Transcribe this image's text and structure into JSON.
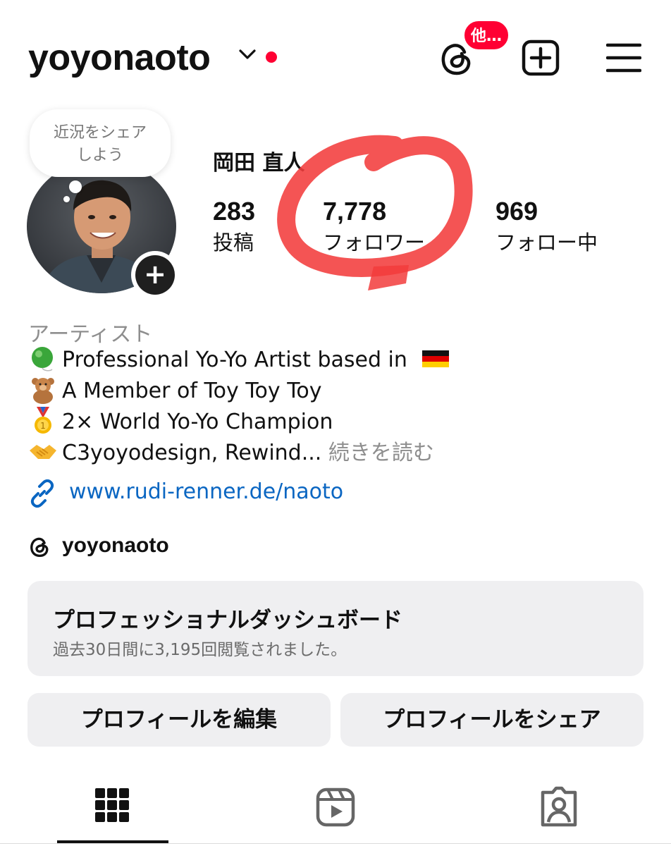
{
  "header": {
    "username": "yoyonaoto",
    "threads_badge": "他…"
  },
  "profile": {
    "full_name": "岡田 直人",
    "note_bubble": [
      "近況をシェア",
      "しよう"
    ],
    "stats": [
      {
        "value": "283",
        "label": "投稿"
      },
      {
        "value": "7,778",
        "label": "フォロワー"
      },
      {
        "value": "969",
        "label": "フォロー中"
      }
    ],
    "category": "アーティスト",
    "bio": [
      {
        "icon": "green-yoyo-emoji",
        "text": "Professional Yo-Yo Artist based in",
        "trail_icon": "germany-flag-emoji"
      },
      {
        "icon": "teddy-bear-emoji",
        "text": "A Member of Toy Toy Toy"
      },
      {
        "icon": "gold-medal-emoji",
        "text": "2× World Yo-Yo Champion"
      },
      {
        "icon": "handshake-emoji",
        "text": "C3yoyodesign, Rewind..."
      }
    ],
    "more_label": "続きを読む",
    "link": "www.rudi-renner.de/naoto",
    "threads_handle": "yoyonaoto"
  },
  "dashboard": {
    "title": "プロフェッショナルダッシュボード",
    "subtitle": "過去30日間に3,195回閲覧されました。"
  },
  "actions": {
    "edit_label": "プロフィールを編集",
    "share_label": "プロフィールをシェア"
  },
  "tabs": [
    "grid-icon",
    "reels-icon",
    "tagged-icon"
  ],
  "colors": {
    "accent_red": "#ff0033",
    "link_blue": "#0a66c2",
    "highlight_marker": "#f23c3c"
  }
}
